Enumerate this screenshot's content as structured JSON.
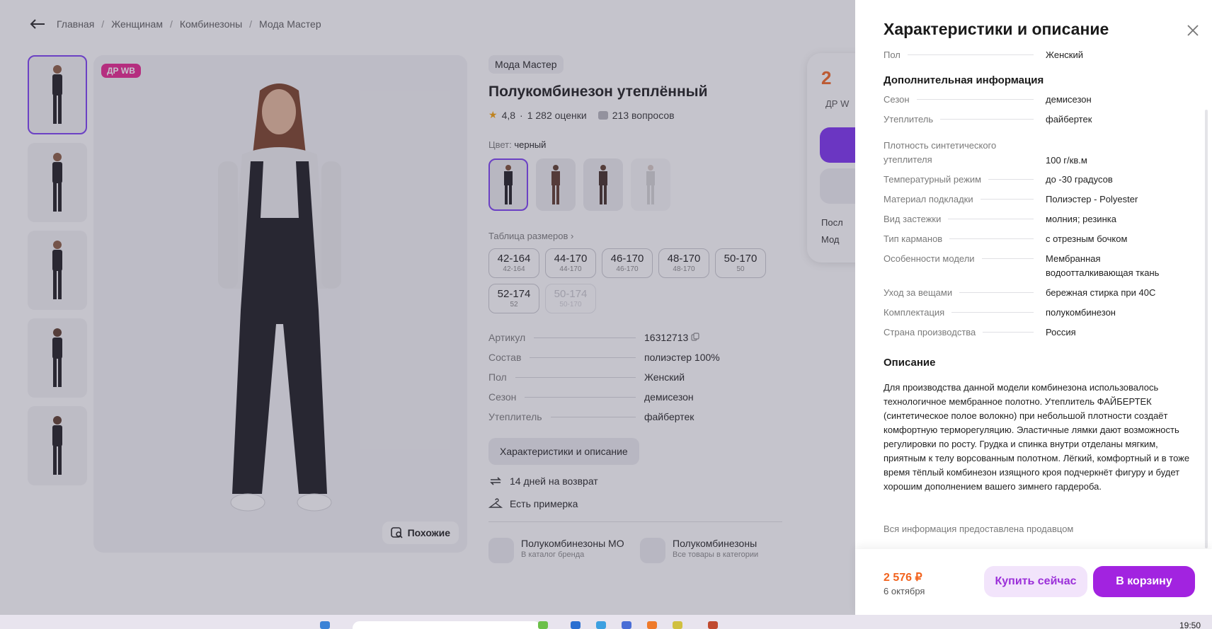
{
  "breadcrumbs": [
    "Главная",
    "Женщинам",
    "Комбинезоны",
    "Мода Мастер"
  ],
  "badge": "ДР WB",
  "similar_label": "Похожие",
  "product": {
    "brand": "Мода Мастер",
    "title": "Полукомбинезон утеплённый",
    "rating": "4,8",
    "ratings_count": "1 282 оценки",
    "questions": "213 вопросов",
    "color_label": "Цвет:",
    "color_value": "черный",
    "size_table": "Таблица размеров",
    "sizes": [
      {
        "main": "42-164",
        "sub": "42-164",
        "available": true
      },
      {
        "main": "44-170",
        "sub": "44-170",
        "available": true
      },
      {
        "main": "46-170",
        "sub": "46-170",
        "available": true
      },
      {
        "main": "48-170",
        "sub": "48-170",
        "available": true
      },
      {
        "main": "50-170",
        "sub": "50",
        "available": true
      },
      {
        "main": "52-174",
        "sub": "52",
        "available": true
      },
      {
        "main": "50-174",
        "sub": "50-170",
        "available": false
      }
    ],
    "specs": [
      {
        "k": "Артикул",
        "v": "16312713"
      },
      {
        "k": "Состав",
        "v": "полиэстер 100%"
      },
      {
        "k": "Пол",
        "v": "Женский"
      },
      {
        "k": "Сезон",
        "v": "демисезон"
      },
      {
        "k": "Утеплитель",
        "v": "файбертек"
      }
    ],
    "char_button": "Характеристики и описание",
    "features": [
      "14 дней на возврат",
      "Есть примерка"
    ],
    "catalog_links": [
      {
        "title": "Полукомбинезоны МО",
        "sub": "В каталог бренда"
      },
      {
        "title": "Полукомбинезоны",
        "sub": "Все товары в категории"
      }
    ]
  },
  "price_card": {
    "price": "2",
    "chip": "ДР W",
    "line1": "Посл",
    "line2": "Мод"
  },
  "panel": {
    "title": "Характеристики и описание",
    "top_row": {
      "k": "Пол",
      "v": "Женский"
    },
    "additional_title": "Дополнительная информация",
    "additional": [
      {
        "k": "Сезон",
        "v": "демисезон"
      },
      {
        "k": "Утеплитель",
        "v": "файбертек"
      },
      {
        "k": "Плотность синтетического утеплителя",
        "v": "100 г/кв.м"
      },
      {
        "k": "Температурный режим",
        "v": "до -30 градусов"
      },
      {
        "k": "Материал подкладки",
        "v": "Полиэстер - Polyester"
      },
      {
        "k": "Вид застежки",
        "v": "молния; резинка"
      },
      {
        "k": "Тип карманов",
        "v": "с отрезным бочком"
      },
      {
        "k": "Особенности модели",
        "v": "Мембранная водоотталкивающая ткань"
      },
      {
        "k": "Уход за вещами",
        "v": "бережная стирка при 40С"
      },
      {
        "k": "Комплектация",
        "v": "полукомбинезон"
      },
      {
        "k": "Страна производства",
        "v": "Россия"
      }
    ],
    "description_title": "Описание",
    "description": "Для производства данной модели комбинезона использовалось технологичное мембранное полотно. Утеплитель ФАЙБЕРТЕК (синтетическое полое волокно) при небольшой плотности создаёт комфортную терморегуляцию. Эластичные лямки дают возможность регулировки по росту. Грудка и спинка внутри отделаны мягким, приятным к телу ворсованным полотном. Лёгкий, комфортный и в тоже время тёплый комбинезон изящного кроя подчеркнёт фигуру и будет хорошим дополнением вашего зимнего гардероба.",
    "note": "Вся информация предоставлена продавцом",
    "footer": {
      "price": "2 576 ₽",
      "date": "6 октября",
      "buy_now": "Купить сейчас",
      "to_cart": "В корзину"
    }
  },
  "taskbar": {
    "clock": "19:50"
  },
  "colors": {
    "accent": "#7b3ef3",
    "price": "#f2631e",
    "cart": "#a223e0",
    "badge": "#e8228e"
  }
}
